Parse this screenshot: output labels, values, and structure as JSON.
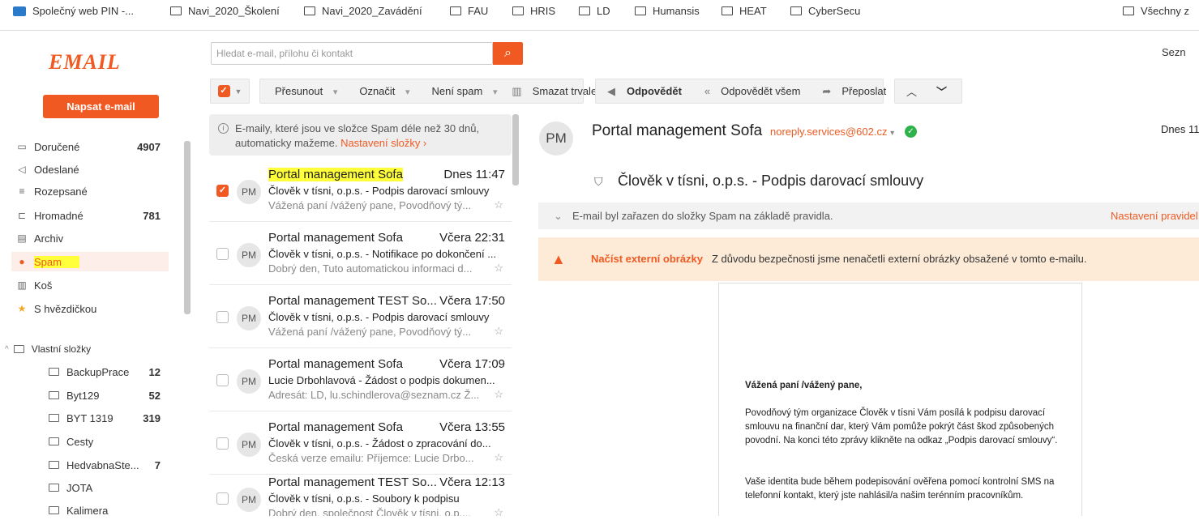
{
  "bookmarks": [
    "Společný web PIN -...",
    "Navi_2020_Školení",
    "Navi_2020_Zavádění",
    "FAU",
    "HRIS",
    "LD",
    "Humansis",
    "HEAT",
    "CyberSecu",
    "Všechny z"
  ],
  "logo": "EMAIL",
  "compose_label": "Napsat e-mail",
  "folders": [
    {
      "label": "Doručené",
      "count": "4907",
      "icon": "inbox-icon",
      "glyph": "▭"
    },
    {
      "label": "Odeslané",
      "count": "",
      "icon": "send-icon",
      "glyph": "◁"
    },
    {
      "label": "Rozepsané",
      "count": "",
      "icon": "draft-icon",
      "glyph": "≡"
    },
    {
      "label": "Hromadné",
      "count": "781",
      "icon": "cart-icon",
      "glyph": "⊏"
    },
    {
      "label": "Archiv",
      "count": "",
      "icon": "archive-icon",
      "glyph": "▤"
    },
    {
      "label": "Spam",
      "count": "",
      "icon": "spam-icon",
      "glyph": "●"
    },
    {
      "label": "Koš",
      "count": "",
      "icon": "trash-icon",
      "glyph": "▥"
    },
    {
      "label": "S hvězdičkou",
      "count": "",
      "icon": "star-icon",
      "glyph": "★"
    }
  ],
  "custom_folders_label": "Vlastní složky",
  "custom_folders": [
    {
      "label": "BackupPrace",
      "count": "12"
    },
    {
      "label": "Byt129",
      "count": "52"
    },
    {
      "label": "BYT 1319",
      "count": "319"
    },
    {
      "label": "Cesty",
      "count": ""
    },
    {
      "label": "HedvabnaSte...",
      "count": "7"
    },
    {
      "label": "JOTA",
      "count": ""
    },
    {
      "label": "Kalimera",
      "count": ""
    }
  ],
  "search_placeholder": "Hledat e-mail, přílohu či kontakt",
  "toolbar": {
    "move": "Přesunout",
    "mark": "Označit",
    "notspam": "Není spam",
    "delete": "Smazat trvale",
    "reply": "Odpovědět",
    "replyall": "Odpovědět všem",
    "forward": "Přeposlat"
  },
  "top_right": "Sezn",
  "notice": {
    "text": "E-maily, které jsou ve složce Spam déle než 30 dnů, automaticky mažeme.",
    "link": "Nastavení složky ›"
  },
  "emails": [
    {
      "initials": "PM",
      "sender": "Portal management Sofa",
      "date": "Dnes 11:47",
      "subject": "Člověk v tísni, o.p.s. - Podpis darovací smlouvy",
      "preview": "Vážená paní /vážený pane,   Povodňový tý...",
      "checked": true
    },
    {
      "initials": "PM",
      "sender": "Portal management Sofa",
      "date": "Včera 22:31",
      "subject": "Člověk v tísni, o.p.s. - Notifikace po dokončení ...",
      "preview": "Dobrý den,   Tuto automatickou informaci d...",
      "checked": false
    },
    {
      "initials": "PM",
      "sender": "Portal management TEST So...",
      "date": "Včera 17:50",
      "subject": "Člověk v tísni, o.p.s. - Podpis darovací smlouvy",
      "preview": "Vážená paní /vážený pane,   Povodňový tý...",
      "checked": false
    },
    {
      "initials": "PM",
      "sender": "Portal management Sofa",
      "date": "Včera 17:09",
      "subject": "Lucie Drbohlavová - Žádost o podpis dokumen...",
      "preview": "Adresát: LD, lu.schindlerova@seznam.cz  Ž...",
      "checked": false
    },
    {
      "initials": "PM",
      "sender": "Portal management Sofa",
      "date": "Včera 13:55",
      "subject": "Člověk v tísni, o.p.s.  - Žádost o zpracování do...",
      "preview": "Česká verze emailu:   Příjemce: Lucie Drbo...",
      "checked": false
    },
    {
      "initials": "PM",
      "sender": "Portal management TEST So...",
      "date": "Včera 12:13",
      "subject": "Člověk v tísni, o.p.s. - Soubory k podpisu",
      "preview": "Dobrý den,   společnost Člověk v tísni, o.p....",
      "checked": false
    }
  ],
  "reader": {
    "initials": "PM",
    "sender": "Portal management Sofa",
    "email": "noreply.services@602.cz",
    "date": "Dnes 11:",
    "subject": "Člověk v tísni, o.p.s. - Podpis darovací smlouvy",
    "spam_note": "E-mail byl zařazen do složky Spam na základě pravidla.",
    "spam_rule_link": "Nastavení pravidel",
    "load_images": "Načíst externí obrázky",
    "images_warning": "Z důvodu bezpečnosti jsme nenačetli externí obrázky obsažené v tomto e-mailu.",
    "greeting": "Vážená paní /vážený pane,",
    "para1": "Povodňový tým organizace Člověk v tísni Vám posílá k podpisu darovací smlouvu na finanční dar, který Vám pomůže pokrýt část škod způsobených povodní. Na konci této zprávy klikněte na odkaz „Podpis darovací smlouvy“.",
    "para2": "Vaše identita bude během podepisování ověřena pomocí kontrolní SMS na telefonní kontakt, který jste nahlásil/a našim terénním pracovníkům."
  },
  "colors": {
    "accent": "#f05a22",
    "highlight": "#ffff3a",
    "verified": "#2db34a"
  }
}
